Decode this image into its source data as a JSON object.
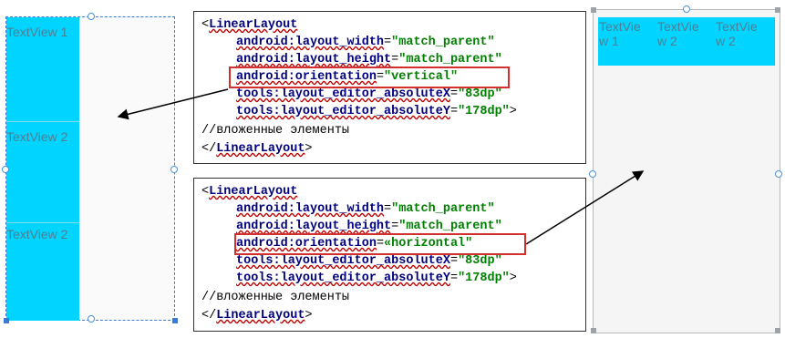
{
  "left_preview": {
    "cells": [
      "TextView 1",
      "TextView 2",
      "TextView 2"
    ],
    "accent": "#00d4ff"
  },
  "code_top": {
    "open_tag": "<",
    "tag": "LinearLayout",
    "attrs": [
      {
        "name": "android:layout_width",
        "eq": "=",
        "value": "\"match_parent\""
      },
      {
        "name": "android:layout_height",
        "eq": "=",
        "value": "\"match_parent\""
      },
      {
        "name": "android:orientation",
        "eq": "=",
        "value": "\"vertical\""
      },
      {
        "name": "tools:layout_editor_absoluteX",
        "eq": "=",
        "value": "\"83dp\""
      },
      {
        "name": "tools:layout_editor_absoluteY",
        "eq": "=",
        "value": "\"178dp\"",
        "close": ">"
      }
    ],
    "comment": "//вложенные элементы",
    "close_prefix": "</",
    "close_tag": "LinearLayout",
    "close_suffix": ">"
  },
  "code_bottom": {
    "open_tag": "<",
    "tag": "LinearLayout",
    "attrs": [
      {
        "name": "android:layout_width",
        "eq": "=",
        "value": "\"match_parent\""
      },
      {
        "name": "android:layout_height",
        "eq": "=",
        "value": "\"match_parent\""
      },
      {
        "name": "android:orientation",
        "eq": "=",
        "value": "«horizontal\""
      },
      {
        "name": "tools:layout_editor_absoluteX",
        "eq": "=",
        "value": "\"83dp\""
      },
      {
        "name": "tools:layout_editor_absoluteY",
        "eq": "=",
        "value": "\"178dp\"",
        "close": ">"
      }
    ],
    "comment": "//вложенные элементы",
    "close_prefix": "</",
    "close_tag": "LinearLayout",
    "close_suffix": ">"
  },
  "right_preview": {
    "cells": [
      "TextVie\nw 1",
      "TextVie\nw 2",
      "TextVie\nw 2"
    ]
  },
  "colors": {
    "highlight": "#d32f2f",
    "keyword": "#000080",
    "string": "#008000"
  }
}
